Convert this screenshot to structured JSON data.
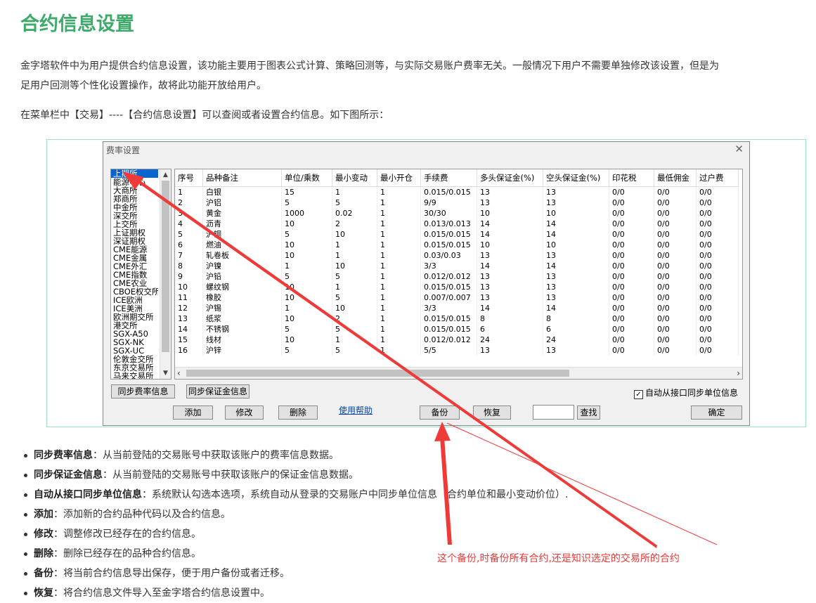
{
  "page": {
    "title": "合约信息设置",
    "intro_line1": "金字塔软件中为用户提供合约信息设置，该功能主要用于图表公式计算、策略回测等，与实际交易账户费率无关。一般情况下用户不需要单独修改该设置，但是为",
    "intro_line2": "足用户回测等个性化设置操作，故将此功能开放给用户。",
    "menu_hint": "在菜单栏中【交易】----【合约信息设置】可以查阅或者设置合约信息。如下图所示："
  },
  "dialog": {
    "title": "费率设置",
    "close_glyph": "✕",
    "exchanges": [
      "上期所",
      "能源中心",
      "大商所",
      "郑商所",
      "中金所",
      "深交所",
      "上交所",
      "上证期权",
      "深证期权",
      "CME能源",
      "CME金属",
      "CME外汇",
      "CME指数",
      "CME农业",
      "CBOE权交所",
      "ICE欧洲",
      "ICE美洲",
      "欧洲期交所",
      "港交所",
      "SGX-A50",
      "SGX-NK",
      "SGX-UC",
      "伦敦金交所",
      "东京交易所",
      "马来交易所"
    ],
    "selected_exchange_index": 0,
    "columns": [
      "序号",
      "品种备注",
      "单位/乘数",
      "最小变动",
      "最小开仓",
      "手续费",
      "多头保证金(%)",
      "空头保证金(%)",
      "印花税",
      "最低佣金",
      "过户费"
    ],
    "rows": [
      [
        "1",
        "白银",
        "15",
        "1",
        "1",
        "0.015/0.015",
        "13",
        "13",
        "0/0",
        "0/0",
        "0/0"
      ],
      [
        "2",
        "沪铝",
        "5",
        "5",
        "1",
        "9/9",
        "13",
        "13",
        "0/0",
        "0/0",
        "0/0"
      ],
      [
        "3",
        "黄金",
        "1000",
        "0.02",
        "1",
        "30/30",
        "10",
        "10",
        "0/0",
        "0/0",
        "0/0"
      ],
      [
        "4",
        "沥青",
        "10",
        "2",
        "1",
        "0.013/0.013",
        "14",
        "14",
        "0/0",
        "0/0",
        "0/0"
      ],
      [
        "5",
        "沪铜",
        "5",
        "10",
        "1",
        "0.015/0.015",
        "14",
        "14",
        "0/0",
        "0/0",
        "0/0"
      ],
      [
        "6",
        "燃油",
        "10",
        "1",
        "1",
        "0.015/0.015",
        "10",
        "10",
        "0/0",
        "0/0",
        "0/0"
      ],
      [
        "7",
        "轧卷板",
        "10",
        "1",
        "1",
        "0.03/0.03",
        "13",
        "13",
        "0/0",
        "0/0",
        "0/0"
      ],
      [
        "8",
        "沪镍",
        "1",
        "10",
        "1",
        "3/3",
        "14",
        "14",
        "0/0",
        "0/0",
        "0/0"
      ],
      [
        "9",
        "沪铅",
        "5",
        "5",
        "1",
        "0.012/0.012",
        "13",
        "13",
        "0/0",
        "0/0",
        "0/0"
      ],
      [
        "10",
        "螺纹钢",
        "10",
        "1",
        "1",
        "0.015/0.015",
        "13",
        "13",
        "0/0",
        "0/0",
        "0/0"
      ],
      [
        "11",
        "橡胶",
        "10",
        "5",
        "1",
        "0.007/0.007",
        "13",
        "13",
        "0/0",
        "0/0",
        "0/0"
      ],
      [
        "12",
        "沪锡",
        "1",
        "10",
        "1",
        "3/3",
        "14",
        "14",
        "0/0",
        "0/0",
        "0/0"
      ],
      [
        "13",
        "纸浆",
        "10",
        "2",
        "1",
        "0.015/0.015",
        "8",
        "8",
        "0/0",
        "0/0",
        "0/0"
      ],
      [
        "14",
        "不锈钢",
        "5",
        "5",
        "1",
        "0.015/0.015",
        "6",
        "6",
        "0/0",
        "0/0",
        "0/0"
      ],
      [
        "15",
        "线材",
        "10",
        "1",
        "1",
        "0.012/0.012",
        "24",
        "24",
        "0/0",
        "0/0",
        "0/0"
      ],
      [
        "16",
        "沪锌",
        "5",
        "5",
        "1",
        "5/5",
        "13",
        "13",
        "0/0",
        "0/0",
        "0/0"
      ]
    ],
    "buttons": {
      "sync_fee": "同步费率信息",
      "sync_margin": "同步保证金信息",
      "add": "添加",
      "edit": "修改",
      "delete": "删除",
      "help": "使用帮助",
      "backup": "备份",
      "restore": "恢复",
      "search": "查找",
      "ok": "确定"
    },
    "auto_sync_label": "自动从接口同步单位信息",
    "auto_sync_checked": true,
    "search_value": ""
  },
  "bullets": [
    {
      "term": "同步费率信息",
      "desc": "：从当前登陆的交易账号中获取该账户的费率信息数据。"
    },
    {
      "term": "同步保证金信息",
      "desc": "：从当前登陆的交易账号中获取该账户的保证金信息数据。"
    },
    {
      "term": "自动从接口同步单位信息",
      "desc": "：系统默认勾选本选项，系统自动从登录的交易账户中同步单位信息（合约单位和最小变动价位）."
    },
    {
      "term": "添加",
      "desc": "：添加新的合约品种代码以及合约信息。"
    },
    {
      "term": "修改",
      "desc": "：调整修改已经存在的合约信息。"
    },
    {
      "term": "删除",
      "desc": "：删除已经存在的品种合约信息。"
    },
    {
      "term": "备份",
      "desc": "：将当前合约信息导出保存，便于用户备份或者迁移。"
    },
    {
      "term": "恢复",
      "desc": "：将合约信息文件导入至金字塔合约信息设置中。"
    }
  ],
  "annotation": {
    "text": "这个备份,时备份所有合约,还是知识选定的交易所的合约",
    "color": "#e83b3b"
  },
  "colors": {
    "title": "#3daa6a",
    "frame": "#9fe0bf",
    "selection": "#0a64d0"
  }
}
